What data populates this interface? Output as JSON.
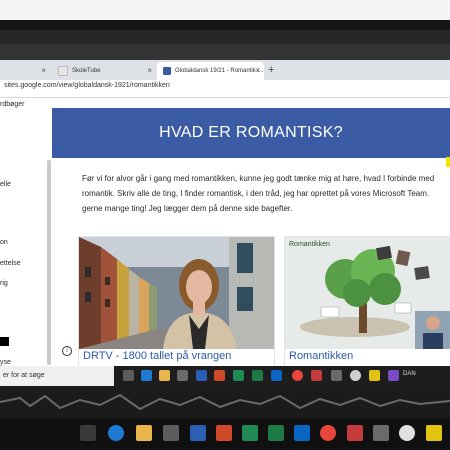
{
  "browser": {
    "tabs": [
      {
        "label": "",
        "active": false
      },
      {
        "label": "SkoleTube",
        "active": false
      },
      {
        "label": "Globaldansk 19/21 - Romantik i...",
        "active": true
      }
    ],
    "new_tab_symbol": "+",
    "close_symbol": "×",
    "url": "sites.google.com/view/globaldansk-1921/romantikken"
  },
  "sidebar": {
    "items": [
      "rdbøger",
      "elle",
      "on",
      "ettelse",
      "rig",
      "yse"
    ]
  },
  "page": {
    "hero_title": "HVAD ER ROMANTISK?",
    "intro_lines": [
      "Før vi for alvor går i gang med romantikken, kunne jeg godt tænke mig at høre, hvad I forbinde med",
      "romantik. Skriv alle de ting, I finder romantisk, i den tråd, jeg har oprettet på vores Microsoft Team.",
      "gerne mange ting! Jeg lægger dem på denne side bagefter."
    ],
    "info_symbol": "i",
    "cards": [
      {
        "title": "DRTV - 1800 tallet på vrangen"
      },
      {
        "title": "Romantikken",
        "image_caption": "Romantikken"
      }
    ]
  },
  "taskbar_inner": {
    "search_placeholder": "er for at søge",
    "tray_text": "DAN"
  },
  "colors": {
    "hero": "#3b5ba5",
    "link": "#2d5aa8",
    "accent_yellow": "#f2e600"
  }
}
